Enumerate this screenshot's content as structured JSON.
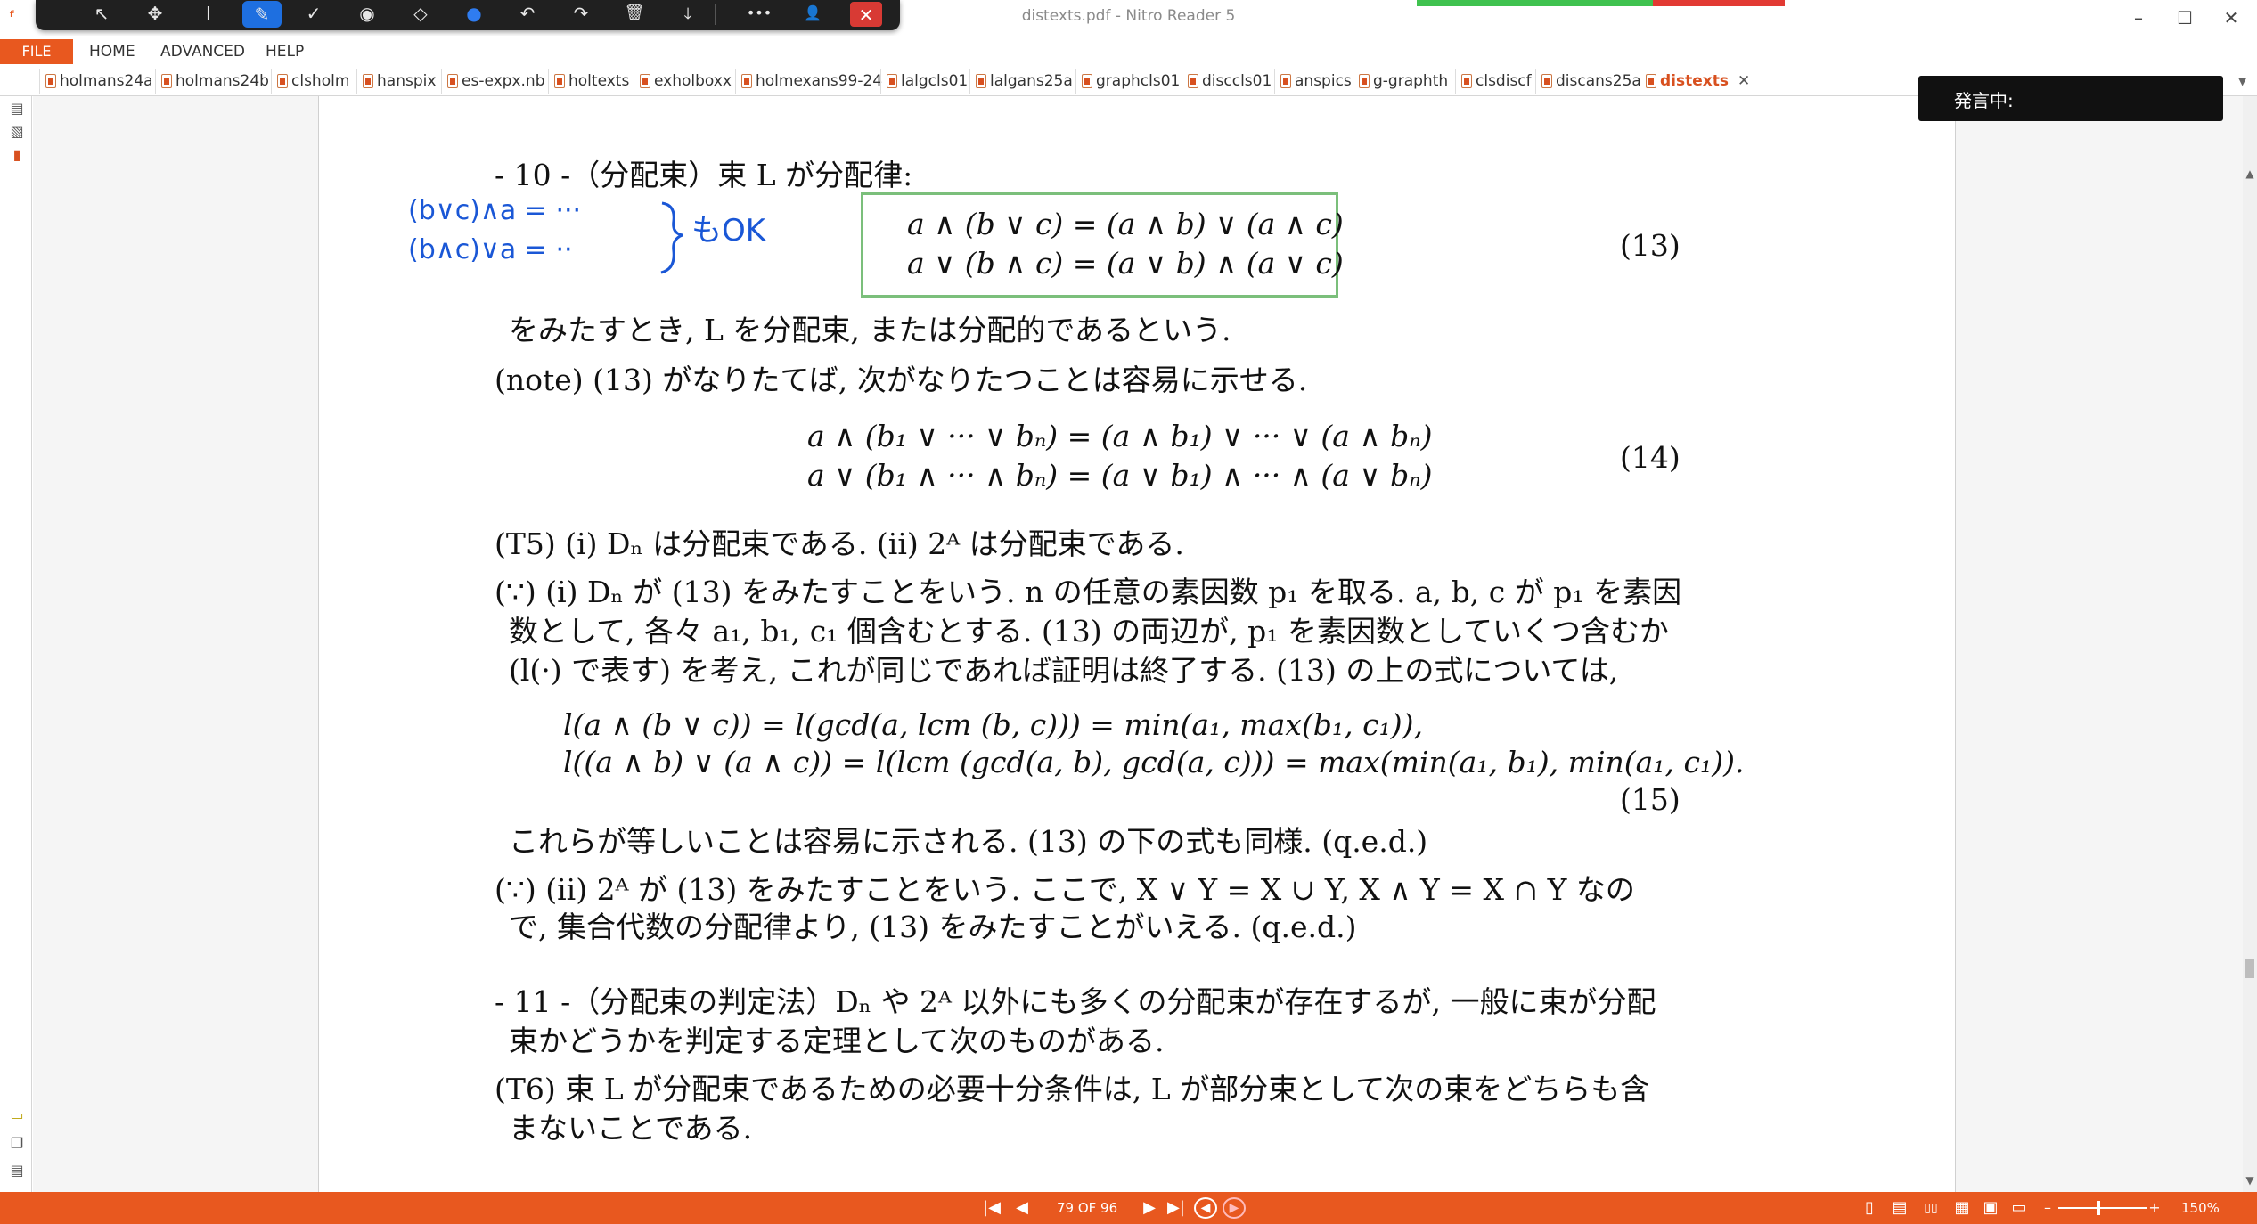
{
  "window": {
    "title": "distexts.pdf - Nitro Reader 5",
    "minimize": "–",
    "maximize": "☐",
    "close": "✕"
  },
  "toolbar": {
    "select": "↖",
    "pan": "✥",
    "text_cursor": "I",
    "pen": "✎",
    "check": "✓",
    "stamp": "◉",
    "eraser": "◇",
    "color": "●",
    "undo": "↶",
    "redo": "↷",
    "delete": "🗑",
    "download": "⤓",
    "more": "•••",
    "user_settings": "👤",
    "close": "✕"
  },
  "menu": {
    "file": "FILE",
    "home": "HOME",
    "advanced": "ADVANCED",
    "help": "HELP"
  },
  "tabs": [
    "holmans24a",
    "holmans24b",
    "clsholm",
    "hanspix",
    "es-expx.nb",
    "holtexts",
    "exholboxx",
    "holmexans99-24",
    "lalgcls01",
    "lalgans25a",
    "graphcls01",
    "disccls01",
    "anspics",
    "g-graphth",
    "clsdiscf",
    "discans25a",
    "distexts"
  ],
  "tab_close": "✕",
  "speaking_label": "発言中:",
  "handwriting": {
    "line1": "(b∨c)∧a = ···",
    "line2": "(b∧c)∨a = ··",
    "note": "もOK"
  },
  "doc": {
    "s10_heading": "- 10 -（分配束）束 L が分配律:",
    "eq13_line1": "a ∧ (b ∨ c) = (a ∧ b) ∨ (a ∧ c)",
    "eq13_line2": "a ∨ (b ∧ c) = (a ∨ b) ∧ (a ∨ c)",
    "eq13_num": "(13)",
    "after13": "をみたすとき, L を分配束, または分配的であるという.",
    "note": "(note)  (13) がなりたてば, 次がなりたつことは容易に示せる.",
    "eq14_line1": "a ∧ (b₁ ∨ ··· ∨ bₙ) = (a ∧ b₁) ∨ ··· ∨ (a ∧ bₙ)",
    "eq14_line2": "a ∨ (b₁ ∧ ··· ∧ bₙ) = (a ∨ b₁) ∧ ··· ∧ (a ∨ bₙ)",
    "eq14_num": "(14)",
    "t5": "(T5)  (i) Dₙ は分配束である.   (ii) 2ᴬ は分配束である.",
    "proof1_line1": "(∵)  (i) Dₙ が (13) をみたすことをいう. n の任意の素因数 p₁ を取る. a, b, c が p₁ を素因",
    "proof1_line2": "数として, 各々 a₁, b₁, c₁ 個含むとする. (13) の両辺が, p₁ を素因数としていくつ含むか",
    "proof1_line3": "(l(·) で表す) を考え, これが同じであれば証明は終了する. (13) の上の式については,",
    "eq15_line1": "l(a ∧ (b ∨ c)) = l(gcd(a, lcm (b, c))) = min(a₁, max(b₁, c₁)),",
    "eq15_line2": "l((a ∧ b) ∨ (a ∧ c)) = l(lcm (gcd(a, b), gcd(a, c))) = max(min(a₁, b₁), min(a₁, c₁)).",
    "eq15_num": "(15)",
    "after15": "これらが等しいことは容易に示される. (13) の下の式も同様.  (q.e.d.)",
    "proof2_line1": "(∵)  (ii) 2ᴬ が (13) をみたすことをいう. ここで, X ∨ Y = X ∪ Y, X ∧ Y = X ∩ Y なの",
    "proof2_line2": "で, 集合代数の分配律より, (13) をみたすことがいえる.  (q.e.d.)",
    "s11_line1": "- 11 -（分配束の判定法）Dₙ や 2ᴬ 以外にも多くの分配束が存在するが, 一般に束が分配",
    "s11_line2": "束かどうかを判定する定理として次のものがある.",
    "t6_line1": "(T6)  束 L が分配束であるための必要十分条件は, L が部分束として次の束をどちらも含",
    "t6_line2": "まないことである."
  },
  "status": {
    "first": "|◀",
    "prev": "◀",
    "page_indicator": "79 OF 96",
    "next": "▶",
    "last": "▶|",
    "back": "◀",
    "forward": "▶",
    "view_single": "▯",
    "view_continuous": "▤",
    "view_facing": "▯▯",
    "view_facing_cont": "▦",
    "view_cover": "▣",
    "view_fullscreen": "▭",
    "zoom_out": "–",
    "zoom_in": "+",
    "zoom_level": "150%"
  },
  "colors": {
    "accent": "#e8581f",
    "green_box": "#7bbf7b",
    "ink": "#1a57d6",
    "progress_green": "#3fc24f",
    "progress_red": "#e23a33"
  }
}
